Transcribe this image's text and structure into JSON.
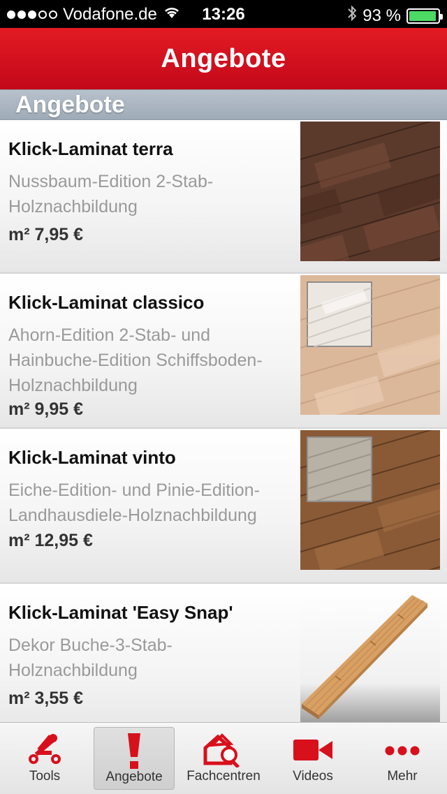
{
  "status_bar": {
    "carrier": "Vodafone.de",
    "time": "13:26",
    "battery_percent": "93 %",
    "signal_bars_filled": 3,
    "signal_bars_total": 5
  },
  "navbar": {
    "title": "Angebote"
  },
  "section": {
    "title": "Angebote"
  },
  "offers": [
    {
      "name": "Klick-Laminat terra",
      "description": "Nussbaum-Edition 2-Stab-Holznachbildung",
      "price": "m² 7,95 €"
    },
    {
      "name": "Klick-Laminat classico",
      "description": "Ahorn-Edition 2-Stab- und Hainbuche-Edition Schiffsboden-Holznachbildung",
      "price": "m² 9,95 €"
    },
    {
      "name": "Klick-Laminat vinto",
      "description": "Eiche-Edition- und Pinie-Edition-Landhausdiele-Holznachbildung",
      "price": "m² 12,95 €"
    },
    {
      "name": "Klick-Laminat 'Easy Snap'",
      "description": "Dekor Buche-3-Stab-Holznachbildung",
      "price": "m² 3,55 €"
    }
  ],
  "tabs": [
    {
      "label": "Tools",
      "icon": "tools-icon"
    },
    {
      "label": "Angebote",
      "icon": "exclamation-icon"
    },
    {
      "label": "Fachcentren",
      "icon": "store-search-icon"
    },
    {
      "label": "Videos",
      "icon": "video-camera-icon"
    },
    {
      "label": "Mehr",
      "icon": "more-dots-icon"
    }
  ],
  "colors": {
    "brand_red": "#d7101c",
    "battery_green": "#4cd964",
    "section_gray": "#a9b4c0"
  }
}
